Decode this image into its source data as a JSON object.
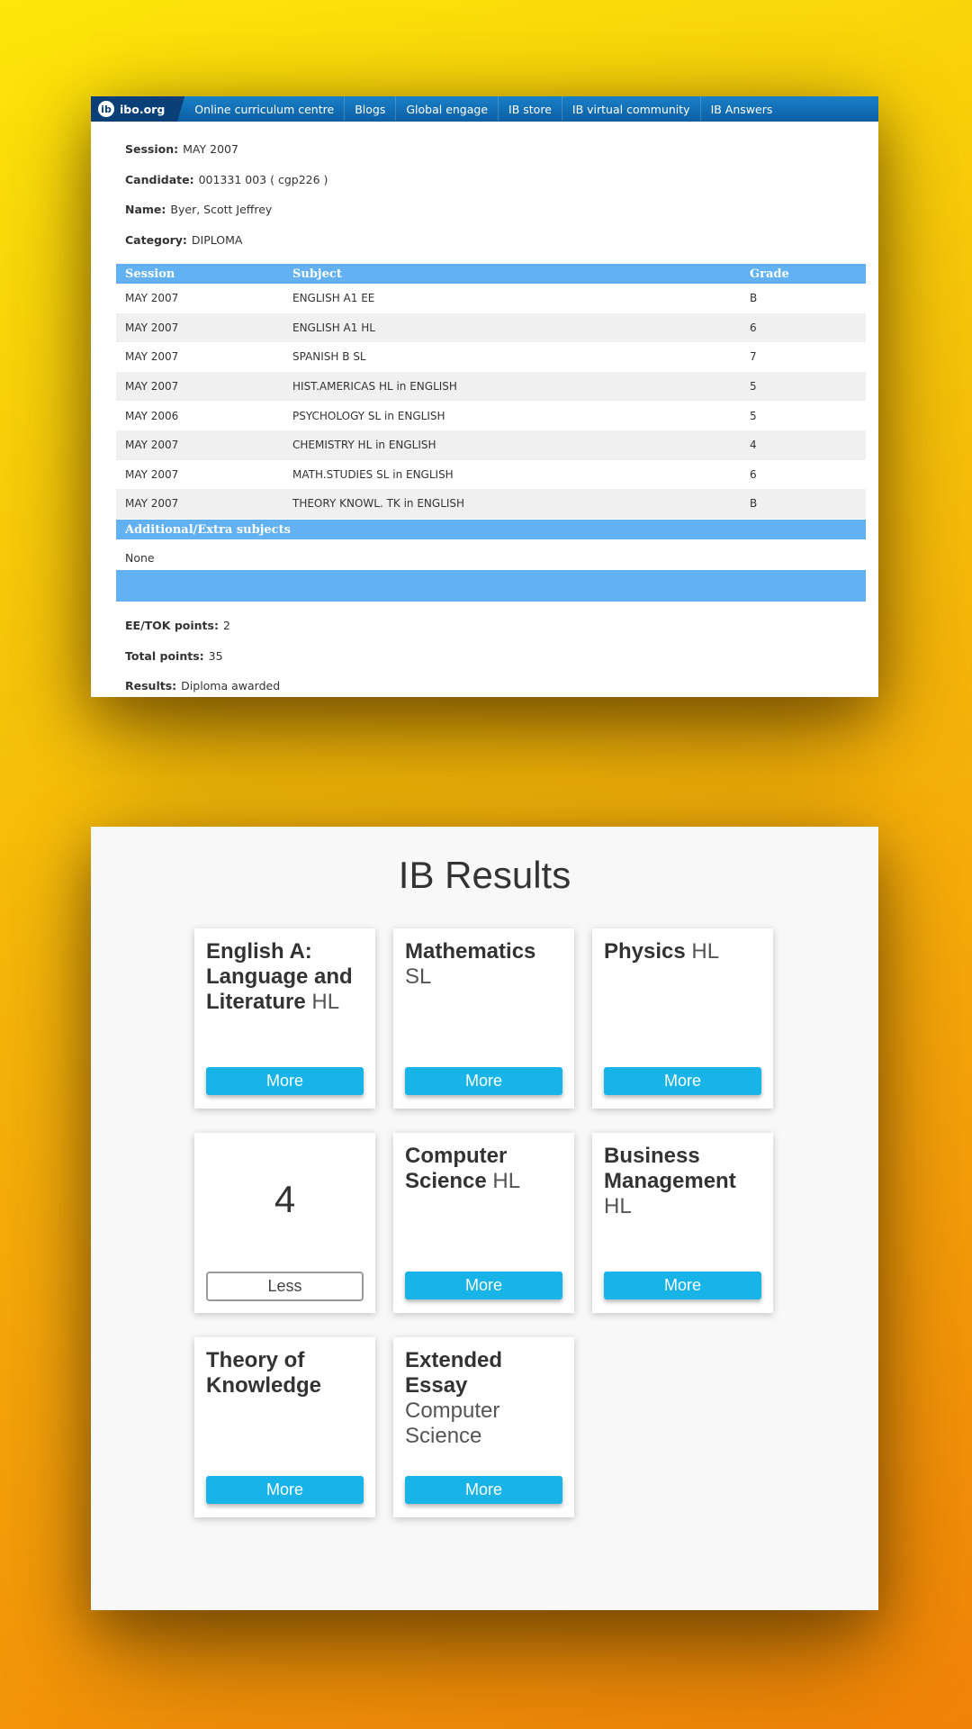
{
  "nav": {
    "logo_mark": "ib",
    "logo_text": "ibo.org",
    "items": [
      "Online curriculum centre",
      "Blogs",
      "Global engage",
      "IB store",
      "IB virtual community",
      "IB Answers"
    ]
  },
  "candidate_info": {
    "session_label": "Session:",
    "session_value": "MAY 2007",
    "candidate_label": "Candidate:",
    "candidate_value": "001331 003 ( cgp226 )",
    "name_label": "Name:",
    "name_value": "Byer, Scott Jeffrey",
    "category_label": "Category:",
    "category_value": "DIPLOMA"
  },
  "grades_table": {
    "headers": [
      "Session",
      "Subject",
      "Grade"
    ],
    "rows": [
      [
        "MAY 2007",
        "ENGLISH A1 EE",
        "B"
      ],
      [
        "MAY 2007",
        "ENGLISH A1 HL",
        "6"
      ],
      [
        "MAY 2007",
        "SPANISH B SL",
        "7"
      ],
      [
        "MAY 2007",
        "HIST.AMERICAS HL in ENGLISH",
        "5"
      ],
      [
        "MAY 2006",
        "PSYCHOLOGY SL in ENGLISH",
        "5"
      ],
      [
        "MAY 2007",
        "CHEMISTRY HL in ENGLISH",
        "4"
      ],
      [
        "MAY 2007",
        "MATH.STUDIES SL in ENGLISH",
        "6"
      ],
      [
        "MAY 2007",
        "THEORY KNOWL. TK in ENGLISH",
        "B"
      ]
    ]
  },
  "extra_subjects": {
    "heading": "Additional/Extra subjects",
    "value": "None"
  },
  "summary": {
    "ee_tok_label": "EE/TOK points:",
    "ee_tok_value": "2",
    "total_label": "Total points:",
    "total_value": "35",
    "results_label": "Results:",
    "results_value": "Diploma awarded"
  },
  "results": {
    "title": "IB Results",
    "cards": [
      {
        "name": "English A: Language and Literature",
        "level": "HL",
        "button": "More"
      },
      {
        "name": "Mathematics",
        "level": "SL",
        "button": "More"
      },
      {
        "name": "Physics",
        "level": "HL",
        "button": "More"
      },
      {
        "grade": "4",
        "button": "Less"
      },
      {
        "name": "Computer Science",
        "level": "HL",
        "button": "More"
      },
      {
        "name": "Business Management",
        "level": "HL",
        "button": "More"
      },
      {
        "name": "Theory of Knowledge",
        "level": "",
        "button": "More"
      },
      {
        "name": "Extended Essay",
        "level": "Computer Science",
        "button": "More"
      }
    ]
  },
  "colors": {
    "nav_blue": "#0b5fa3",
    "table_header_blue": "#62b1f5",
    "more_button": "#18b4e8",
    "background_gradient_start": "#fde60a",
    "background_gradient_end": "#f08208"
  }
}
